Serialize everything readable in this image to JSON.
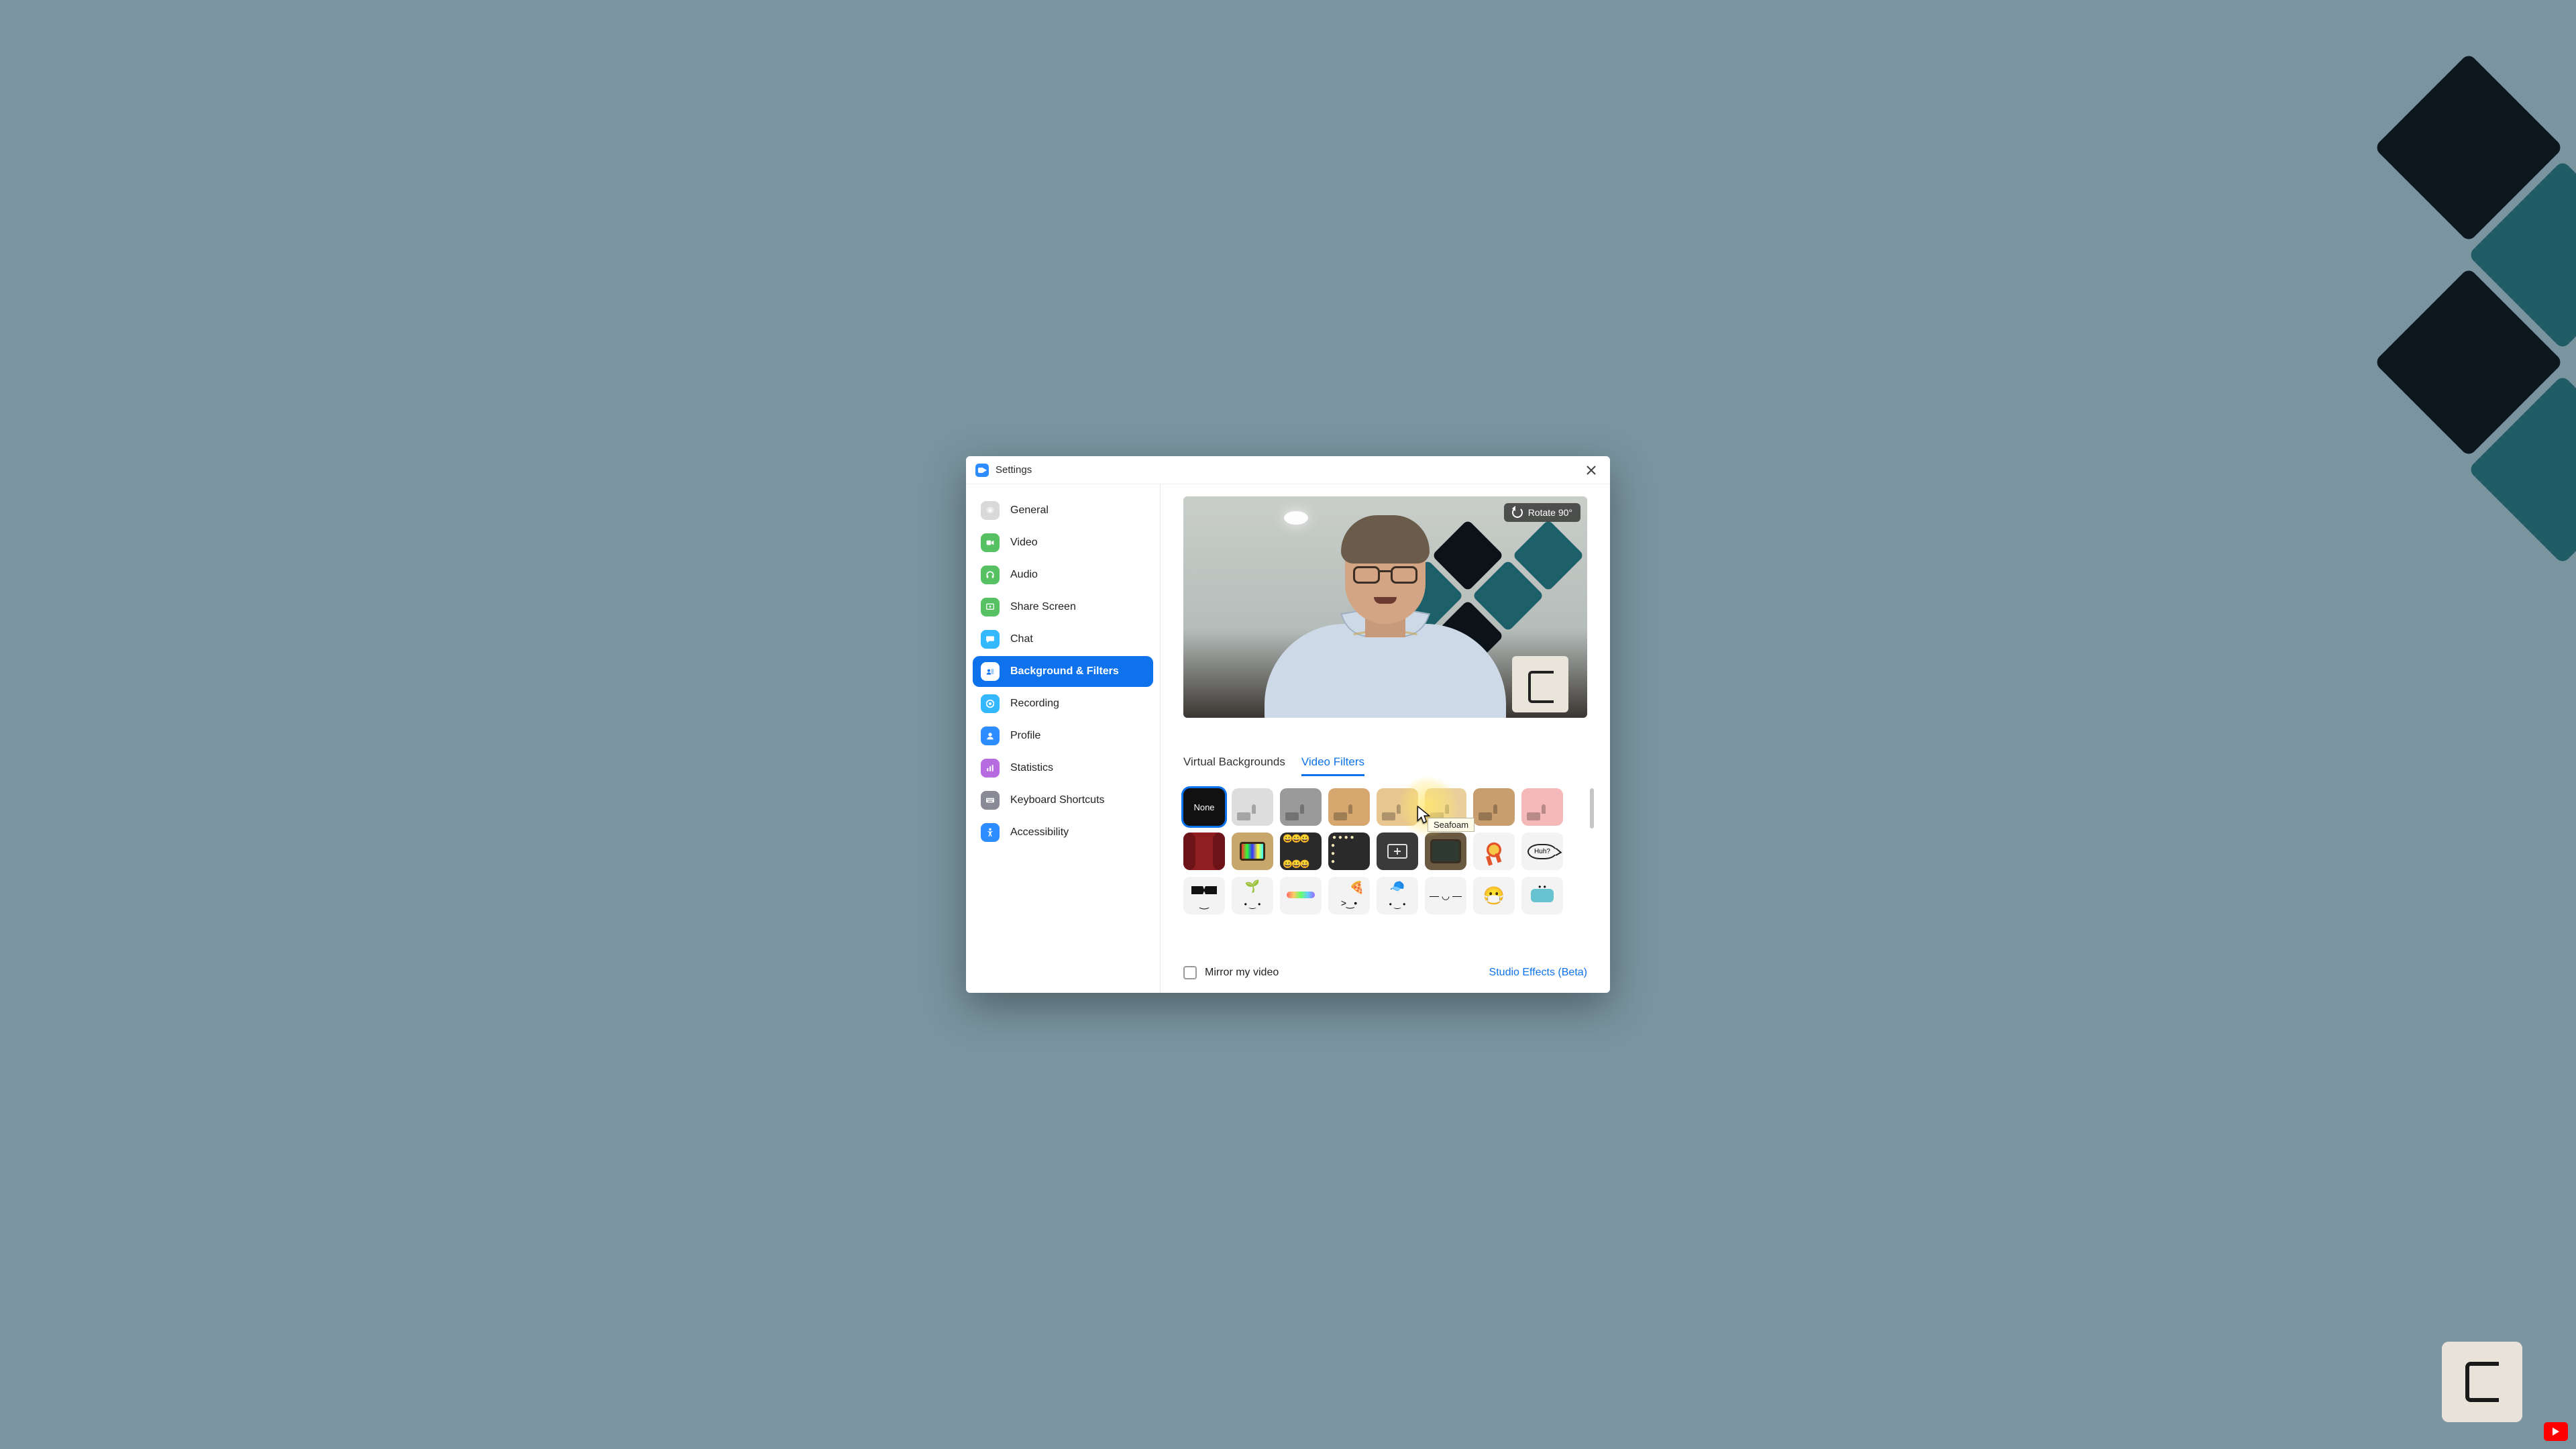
{
  "window": {
    "title": "Settings"
  },
  "sidebar": {
    "items": [
      {
        "id": "general",
        "label": "General"
      },
      {
        "id": "video",
        "label": "Video"
      },
      {
        "id": "audio",
        "label": "Audio"
      },
      {
        "id": "share-screen",
        "label": "Share Screen"
      },
      {
        "id": "chat",
        "label": "Chat"
      },
      {
        "id": "background-filters",
        "label": "Background & Filters",
        "active": true
      },
      {
        "id": "recording",
        "label": "Recording"
      },
      {
        "id": "profile",
        "label": "Profile"
      },
      {
        "id": "statistics",
        "label": "Statistics"
      },
      {
        "id": "keyboard-shortcuts",
        "label": "Keyboard Shortcuts"
      },
      {
        "id": "accessibility",
        "label": "Accessibility"
      }
    ]
  },
  "preview": {
    "rotate_label": "Rotate 90°"
  },
  "tabs": {
    "virtual_backgrounds": "Virtual Backgrounds",
    "video_filters": "Video Filters",
    "active": "video_filters"
  },
  "filters": {
    "none_label": "None",
    "selected": "none",
    "hover_tooltip": "Seafoam",
    "row1": [
      "none",
      "black-and-white",
      "gray",
      "sepia-warm",
      "sepia-light",
      "seafoam",
      "sepia-dark",
      "pink"
    ],
    "row2": [
      "theater-curtains",
      "retro-tv-bars",
      "emoji-border",
      "vanity-lights",
      "crop-frame",
      "old-tv",
      "award-ribbon",
      "speech-huh"
    ],
    "row3": [
      "deal-sunglasses",
      "sprout-face",
      "rainbow-cheeks",
      "pizza-face",
      "baseball-cap",
      "wide-smile",
      "face-mask-n95",
      "surgical-mask"
    ],
    "huh_text": "Huh?"
  },
  "footer": {
    "mirror_label": "Mirror my video",
    "mirror_checked": false,
    "studio_effects": "Studio Effects (Beta)"
  },
  "colors": {
    "accent": "#0e72ed"
  }
}
